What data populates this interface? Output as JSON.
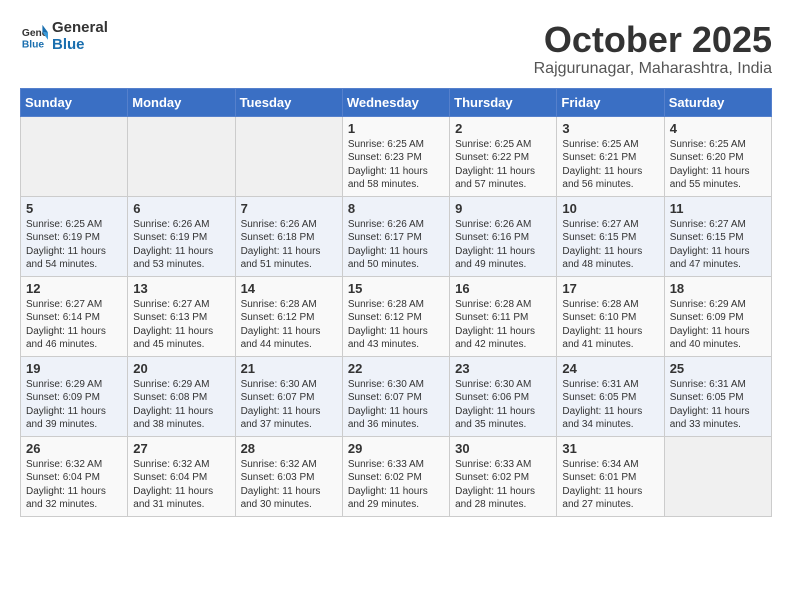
{
  "header": {
    "logo_general": "General",
    "logo_blue": "Blue",
    "month_title": "October 2025",
    "location": "Rajgurunagar, Maharashtra, India"
  },
  "weekdays": [
    "Sunday",
    "Monday",
    "Tuesday",
    "Wednesday",
    "Thursday",
    "Friday",
    "Saturday"
  ],
  "weeks": [
    [
      {
        "day": "",
        "content": ""
      },
      {
        "day": "",
        "content": ""
      },
      {
        "day": "",
        "content": ""
      },
      {
        "day": "1",
        "content": "Sunrise: 6:25 AM\nSunset: 6:23 PM\nDaylight: 11 hours\nand 58 minutes."
      },
      {
        "day": "2",
        "content": "Sunrise: 6:25 AM\nSunset: 6:22 PM\nDaylight: 11 hours\nand 57 minutes."
      },
      {
        "day": "3",
        "content": "Sunrise: 6:25 AM\nSunset: 6:21 PM\nDaylight: 11 hours\nand 56 minutes."
      },
      {
        "day": "4",
        "content": "Sunrise: 6:25 AM\nSunset: 6:20 PM\nDaylight: 11 hours\nand 55 minutes."
      }
    ],
    [
      {
        "day": "5",
        "content": "Sunrise: 6:25 AM\nSunset: 6:19 PM\nDaylight: 11 hours\nand 54 minutes."
      },
      {
        "day": "6",
        "content": "Sunrise: 6:26 AM\nSunset: 6:19 PM\nDaylight: 11 hours\nand 53 minutes."
      },
      {
        "day": "7",
        "content": "Sunrise: 6:26 AM\nSunset: 6:18 PM\nDaylight: 11 hours\nand 51 minutes."
      },
      {
        "day": "8",
        "content": "Sunrise: 6:26 AM\nSunset: 6:17 PM\nDaylight: 11 hours\nand 50 minutes."
      },
      {
        "day": "9",
        "content": "Sunrise: 6:26 AM\nSunset: 6:16 PM\nDaylight: 11 hours\nand 49 minutes."
      },
      {
        "day": "10",
        "content": "Sunrise: 6:27 AM\nSunset: 6:15 PM\nDaylight: 11 hours\nand 48 minutes."
      },
      {
        "day": "11",
        "content": "Sunrise: 6:27 AM\nSunset: 6:15 PM\nDaylight: 11 hours\nand 47 minutes."
      }
    ],
    [
      {
        "day": "12",
        "content": "Sunrise: 6:27 AM\nSunset: 6:14 PM\nDaylight: 11 hours\nand 46 minutes."
      },
      {
        "day": "13",
        "content": "Sunrise: 6:27 AM\nSunset: 6:13 PM\nDaylight: 11 hours\nand 45 minutes."
      },
      {
        "day": "14",
        "content": "Sunrise: 6:28 AM\nSunset: 6:12 PM\nDaylight: 11 hours\nand 44 minutes."
      },
      {
        "day": "15",
        "content": "Sunrise: 6:28 AM\nSunset: 6:12 PM\nDaylight: 11 hours\nand 43 minutes."
      },
      {
        "day": "16",
        "content": "Sunrise: 6:28 AM\nSunset: 6:11 PM\nDaylight: 11 hours\nand 42 minutes."
      },
      {
        "day": "17",
        "content": "Sunrise: 6:28 AM\nSunset: 6:10 PM\nDaylight: 11 hours\nand 41 minutes."
      },
      {
        "day": "18",
        "content": "Sunrise: 6:29 AM\nSunset: 6:09 PM\nDaylight: 11 hours\nand 40 minutes."
      }
    ],
    [
      {
        "day": "19",
        "content": "Sunrise: 6:29 AM\nSunset: 6:09 PM\nDaylight: 11 hours\nand 39 minutes."
      },
      {
        "day": "20",
        "content": "Sunrise: 6:29 AM\nSunset: 6:08 PM\nDaylight: 11 hours\nand 38 minutes."
      },
      {
        "day": "21",
        "content": "Sunrise: 6:30 AM\nSunset: 6:07 PM\nDaylight: 11 hours\nand 37 minutes."
      },
      {
        "day": "22",
        "content": "Sunrise: 6:30 AM\nSunset: 6:07 PM\nDaylight: 11 hours\nand 36 minutes."
      },
      {
        "day": "23",
        "content": "Sunrise: 6:30 AM\nSunset: 6:06 PM\nDaylight: 11 hours\nand 35 minutes."
      },
      {
        "day": "24",
        "content": "Sunrise: 6:31 AM\nSunset: 6:05 PM\nDaylight: 11 hours\nand 34 minutes."
      },
      {
        "day": "25",
        "content": "Sunrise: 6:31 AM\nSunset: 6:05 PM\nDaylight: 11 hours\nand 33 minutes."
      }
    ],
    [
      {
        "day": "26",
        "content": "Sunrise: 6:32 AM\nSunset: 6:04 PM\nDaylight: 11 hours\nand 32 minutes."
      },
      {
        "day": "27",
        "content": "Sunrise: 6:32 AM\nSunset: 6:04 PM\nDaylight: 11 hours\nand 31 minutes."
      },
      {
        "day": "28",
        "content": "Sunrise: 6:32 AM\nSunset: 6:03 PM\nDaylight: 11 hours\nand 30 minutes."
      },
      {
        "day": "29",
        "content": "Sunrise: 6:33 AM\nSunset: 6:02 PM\nDaylight: 11 hours\nand 29 minutes."
      },
      {
        "day": "30",
        "content": "Sunrise: 6:33 AM\nSunset: 6:02 PM\nDaylight: 11 hours\nand 28 minutes."
      },
      {
        "day": "31",
        "content": "Sunrise: 6:34 AM\nSunset: 6:01 PM\nDaylight: 11 hours\nand 27 minutes."
      },
      {
        "day": "",
        "content": ""
      }
    ]
  ]
}
